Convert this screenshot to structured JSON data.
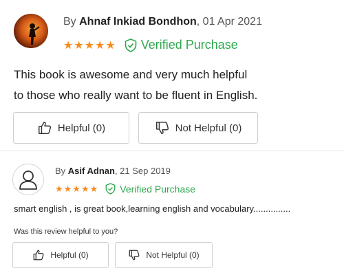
{
  "reviews": [
    {
      "by_prefix": "By",
      "author": "Ahnaf Inkiad Bondhon",
      "date": ", 01 Apr 2021",
      "stars": "★★★★★",
      "rating": 5,
      "verified_label": "Verified Purchase",
      "body_line1": "This book is awesome and very much helpful",
      "body_line2": "to those who really want to be fluent in English.",
      "helpful_label": "Helpful (0)",
      "not_helpful_label": "Not Helpful (0)"
    },
    {
      "by_prefix": "By",
      "author": "Asif Adnan",
      "date": ", 21 Sep 2019",
      "stars": "★★★★★",
      "rating": 5,
      "verified_label": "Verified Purchase",
      "body": "smart english , is great book,learning english and vocabulary...............",
      "question": "Was this review helpful to you?",
      "helpful_label": "Helpful (0)",
      "not_helpful_label": "Not Helpful (0)"
    }
  ],
  "colors": {
    "star": "#f68b1e",
    "verified": "#2fa84f"
  },
  "icons": [
    "avatar-photo",
    "default-avatar-icon",
    "shield-check-icon",
    "thumbs-up-icon",
    "thumbs-down-icon"
  ]
}
